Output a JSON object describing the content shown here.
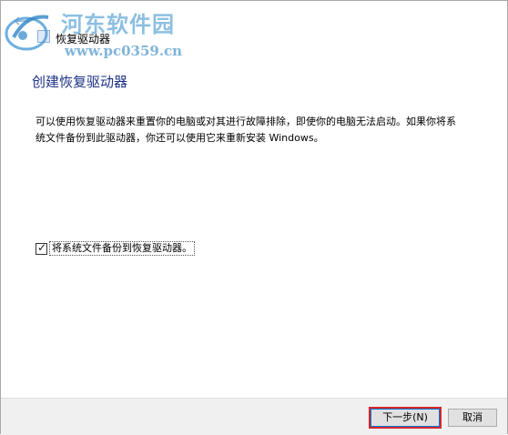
{
  "window": {
    "title": "恢复驱动器",
    "back_icon": "back-arrow-icon"
  },
  "watermark": {
    "name": "河东软件园",
    "url": "www.pc0359.cn"
  },
  "main": {
    "heading": "创建恢复驱动器",
    "description": "可以使用恢复驱动器来重置你的电脑或对其进行故障排除，即使你的电脑无法启动。如果你将系统文件备份到此驱动器，你还可以使用它来重新安装 Windows。",
    "checkbox": {
      "label": "将系统文件备份到恢复驱动器。",
      "checked": true
    }
  },
  "footer": {
    "next_label": "下一步(N)",
    "cancel_label": "取消"
  },
  "colors": {
    "heading": "#1e3287",
    "focus_highlight": "#d9262b",
    "footer_bg": "#f0f0f0"
  }
}
